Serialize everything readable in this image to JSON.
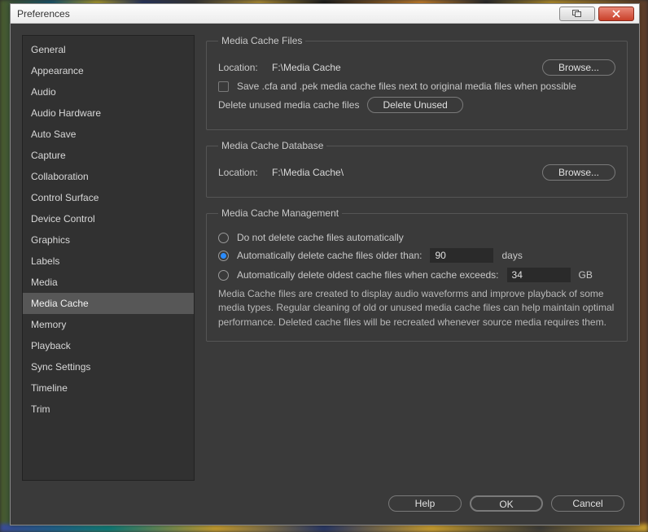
{
  "window": {
    "title": "Preferences"
  },
  "sidebar": {
    "items": [
      "General",
      "Appearance",
      "Audio",
      "Audio Hardware",
      "Auto Save",
      "Capture",
      "Collaboration",
      "Control Surface",
      "Device Control",
      "Graphics",
      "Labels",
      "Media",
      "Media Cache",
      "Memory",
      "Playback",
      "Sync Settings",
      "Timeline",
      "Trim"
    ],
    "selectedIndex": 12
  },
  "files": {
    "legend": "Media Cache Files",
    "location_label": "Location:",
    "location_value": "F:\\Media Cache",
    "browse": "Browse...",
    "save_next_label": "Save .cfa and .pek media cache files next to original media files when possible",
    "save_next_checked": false,
    "delete_unused_label": "Delete unused media cache files",
    "delete_unused_button": "Delete Unused"
  },
  "database": {
    "legend": "Media Cache Database",
    "location_label": "Location:",
    "location_value": "F:\\Media Cache\\",
    "browse": "Browse..."
  },
  "management": {
    "legend": "Media Cache Management",
    "opt_no_delete": "Do not delete cache files automatically",
    "opt_older_than": "Automatically delete cache files older than:",
    "older_than_value": "90",
    "older_than_unit": "days",
    "opt_exceeds": "Automatically delete oldest cache files when cache exceeds:",
    "exceeds_value": "34",
    "exceeds_unit": "GB",
    "selected": "older_than",
    "description": "Media Cache files are created to display audio waveforms and improve playback of some media types.  Regular cleaning of old or unused media cache files can help maintain optimal performance. Deleted cache files will be recreated whenever source media requires them."
  },
  "footer": {
    "help": "Help",
    "ok": "OK",
    "cancel": "Cancel"
  }
}
